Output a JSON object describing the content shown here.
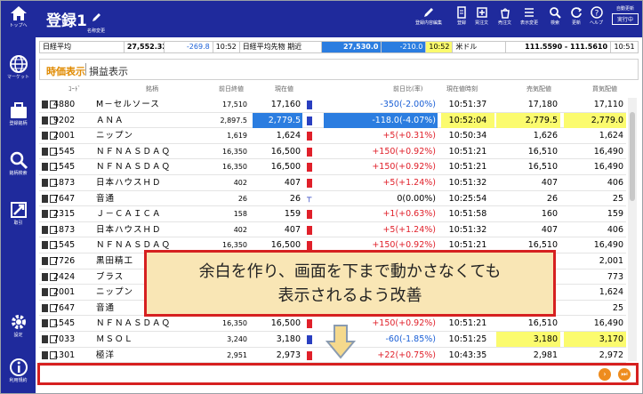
{
  "sidebar": {
    "items": [
      {
        "label": "トップへ",
        "icon": "home-icon"
      },
      {
        "label": "マーケット",
        "icon": "globe-icon"
      },
      {
        "label": "登録銘柄",
        "icon": "briefcase-icon"
      },
      {
        "label": "銘柄検索",
        "icon": "search-icon"
      },
      {
        "label": "取引",
        "icon": "trade-icon"
      },
      {
        "label": "設定",
        "icon": "gear-icon"
      },
      {
        "label": "利用規約",
        "icon": "info-icon"
      }
    ]
  },
  "header": {
    "title": "登録1",
    "rename_label": "名称変更",
    "buttons": [
      {
        "label": "登録内容編集",
        "icon": "edit-icon"
      },
      {
        "label": "登録",
        "icon": "register-icon"
      },
      {
        "label": "買注文",
        "icon": "buy-order-icon"
      },
      {
        "label": "売注文",
        "icon": "sell-order-icon"
      },
      {
        "label": "表示変更",
        "icon": "display-icon"
      },
      {
        "label": "検索",
        "icon": "search-icon"
      },
      {
        "label": "更新",
        "icon": "refresh-icon"
      },
      {
        "label": "ヘルプ",
        "icon": "help-icon"
      }
    ],
    "auto_refresh": {
      "label": "自動更新",
      "button": "実行中"
    }
  },
  "ticker": {
    "nikkei_label": "日経平均",
    "nikkei_value": "27,552.32",
    "nikkei_change": "-269.8",
    "nikkei_time": "10:52",
    "futures_label": "日経平均先物 期近",
    "futures_value": "27,530.0",
    "futures_change": "-210.0",
    "futures_time": "10:52",
    "fx_label": "米ドル",
    "fx_value": "111.5590 - 111.5610",
    "fx_time": "10:51"
  },
  "tabs": {
    "active": "時価表示",
    "other": "損益表示"
  },
  "table": {
    "headers": {
      "code": "ｺｰﾄﾞ",
      "name": "銘柄",
      "prev": "前日終値",
      "current": "現在値",
      "change": "前日比(率)",
      "time": "現在値時刻",
      "sell": "売気配値",
      "buy": "買気配値"
    },
    "rows": [
      {
        "code": "4880",
        "name": "M－セルソース",
        "prev": "17,510",
        "current": "17,160",
        "change": "-350(-2.00%)",
        "time": "10:51:37",
        "sell": "17,180",
        "buy": "17,110",
        "dir": "neg"
      },
      {
        "code": "9202",
        "name": "ＡＮＡ",
        "prev": "2,897.5",
        "current": "2,779.5",
        "change": "-118.0(-4.07%)",
        "time": "10:52:04",
        "sell": "2,779.5",
        "buy": "2,779.0",
        "dir": "neg",
        "hl": true
      },
      {
        "code": "2001",
        "name": "ニップン",
        "prev": "1,619",
        "current": "1,624",
        "change": "+5(+0.31%)",
        "time": "10:50:34",
        "sell": "1,626",
        "buy": "1,624",
        "dir": "pos"
      },
      {
        "code": "1545",
        "name": "ＮＦＮＡＳＤＡＱ",
        "prev": "16,350",
        "current": "16,500",
        "change": "+150(+0.92%)",
        "time": "10:51:21",
        "sell": "16,510",
        "buy": "16,490",
        "dir": "pos"
      },
      {
        "code": "1545",
        "name": "ＮＦＮＡＳＤＡＱ",
        "prev": "16,350",
        "current": "16,500",
        "change": "+150(+0.92%)",
        "time": "10:51:21",
        "sell": "16,510",
        "buy": "16,490",
        "dir": "pos"
      },
      {
        "code": "1873",
        "name": "日本ハウスＨＤ",
        "prev": "402",
        "current": "407",
        "change": "+5(+1.24%)",
        "time": "10:51:32",
        "sell": "407",
        "buy": "406",
        "dir": "pos"
      },
      {
        "code": "7647",
        "name": "音通",
        "prev": "26",
        "current": "26",
        "change": "0(0.00%)",
        "time": "10:25:54",
        "sell": "26",
        "buy": "25",
        "dir": "zero"
      },
      {
        "code": "2315",
        "name": "Ｊ－ＣＡＩＣＡ",
        "prev": "158",
        "current": "159",
        "change": "+1(+0.63%)",
        "time": "10:51:58",
        "sell": "160",
        "buy": "159",
        "dir": "pos"
      },
      {
        "code": "1873",
        "name": "日本ハウスＨＤ",
        "prev": "402",
        "current": "407",
        "change": "+5(+1.24%)",
        "time": "10:51:32",
        "sell": "407",
        "buy": "406",
        "dir": "pos"
      },
      {
        "code": "1545",
        "name": "ＮＦＮＡＳＤＡＱ",
        "prev": "16,350",
        "current": "16,500",
        "change": "+150(+0.92%)",
        "time": "10:51:21",
        "sell": "16,510",
        "buy": "16,490",
        "dir": "pos"
      },
      {
        "code": "7726",
        "name": "黒田精工",
        "prev": "",
        "current": "",
        "change": "",
        "time": "",
        "sell": "",
        "buy": "2,001",
        "dir": "pos"
      },
      {
        "code": "2424",
        "name": "ブラス",
        "prev": "",
        "current": "",
        "change": "",
        "time": "",
        "sell": "",
        "buy": "773",
        "dir": "pos"
      },
      {
        "code": "2001",
        "name": "ニップン",
        "prev": "",
        "current": "",
        "change": "",
        "time": "",
        "sell": "",
        "buy": "1,624",
        "dir": "pos"
      },
      {
        "code": "7647",
        "name": "音通",
        "prev": "",
        "current": "",
        "change": "",
        "time": "",
        "sell": "",
        "buy": "25",
        "dir": "zero"
      },
      {
        "code": "1545",
        "name": "ＮＦＮＡＳＤＡＱ",
        "prev": "16,350",
        "current": "16,500",
        "change": "+150(+0.92%)",
        "time": "10:51:21",
        "sell": "16,510",
        "buy": "16,490",
        "dir": "pos"
      },
      {
        "code": "7033",
        "name": "ＭＳＯＬ",
        "prev": "3,240",
        "current": "3,180",
        "change": "-60(-1.85%)",
        "time": "10:51:25",
        "sell": "3,180",
        "buy": "3,170",
        "dir": "neg",
        "yellow_quotes": true
      },
      {
        "code": "1301",
        "name": "極洋",
        "prev": "2,951",
        "current": "2,973",
        "change": "+22(+0.75%)",
        "time": "10:43:35",
        "sell": "2,981",
        "buy": "2,972",
        "dir": "pos"
      }
    ]
  },
  "callout": {
    "line1": "余白を作り、画面を下まで動かさなくても",
    "line2": "表示されるよう改善"
  },
  "pager": {
    "next": "›",
    "last": "⏭"
  },
  "colors": {
    "brand": "#1f2a9c",
    "accent": "#e08a00",
    "highlight_blue": "#2b7de0",
    "highlight_yellow": "#fbfb6e",
    "alert_red": "#d62020"
  }
}
